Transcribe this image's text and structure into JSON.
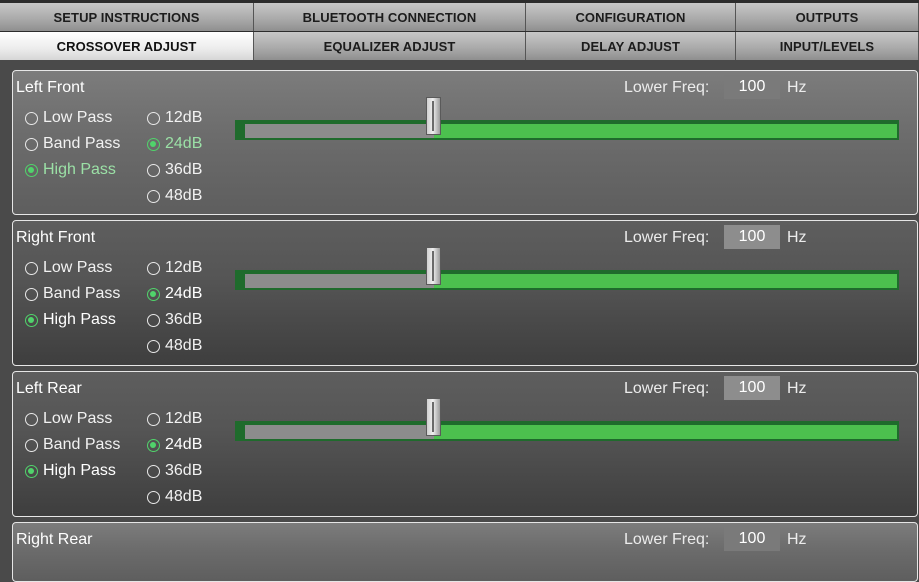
{
  "tabs": {
    "row1": [
      "SETUP INSTRUCTIONS",
      "BLUETOOTH CONNECTION",
      "CONFIGURATION",
      "OUTPUTS"
    ],
    "row2": [
      "CROSSOVER ADJUST",
      "EQUALIZER ADJUST",
      "DELAY ADJUST",
      "INPUT/LEVELS"
    ],
    "active": "CROSSOVER ADJUST"
  },
  "filter_types": [
    "Low Pass",
    "Band Pass",
    "High Pass"
  ],
  "slopes": [
    "12dB",
    "24dB",
    "36dB",
    "48dB"
  ],
  "colors": {
    "accent": "#50d36b",
    "track_active": "#4cc04e",
    "track_inactive": "#8c8c8c"
  },
  "channels": [
    {
      "name": "Left Front",
      "freq_label": "Lower Freq:",
      "freq_value": "100",
      "freq_unit": "Hz",
      "filter": "High Pass",
      "slope": "24dB",
      "slider_fraction": 0.29
    },
    {
      "name": "Right Front",
      "freq_label": "Lower Freq:",
      "freq_value": "100",
      "freq_unit": "Hz",
      "filter": "High Pass",
      "slope": "24dB",
      "slider_fraction": 0.29
    },
    {
      "name": "Left Rear",
      "freq_label": "Lower Freq:",
      "freq_value": "100",
      "freq_unit": "Hz",
      "filter": "High Pass",
      "slope": "24dB",
      "slider_fraction": 0.29
    },
    {
      "name": "Right Rear",
      "freq_label": "Lower Freq:",
      "freq_value": "100",
      "freq_unit": "Hz"
    }
  ]
}
